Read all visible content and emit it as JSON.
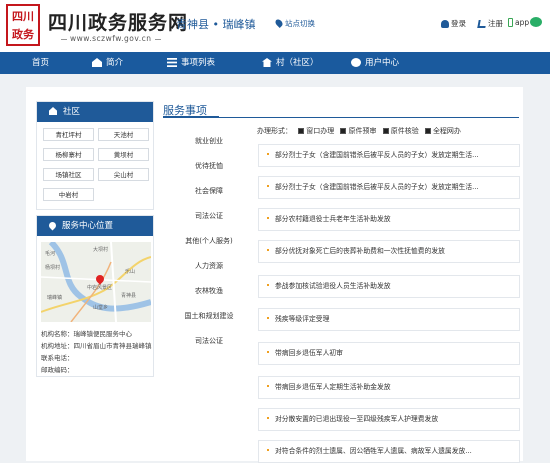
{
  "header": {
    "seal_text": "四川政务",
    "site_title": "四川政务服务网",
    "url": "www.sczwfw.gov.cn",
    "region": "青神县 • 瑞峰镇",
    "switch_label": "站点切换",
    "login_label": "登录",
    "register_label": "注册",
    "app_label": "app"
  },
  "nav": {
    "home": "首页",
    "intro": "简介",
    "list": "事项列表",
    "village": "村（社区）",
    "user": "用户中心"
  },
  "community": {
    "title": "社区",
    "villages": [
      "青杠坪村",
      "天池村",
      "杨柳寨村",
      "黄坝村",
      "场镇社区",
      "尖山村",
      "中岩村"
    ]
  },
  "location": {
    "title": "服务中心位置",
    "map_labels": [
      "毛河",
      "大坝村",
      "杨坝村",
      "乐山",
      "中岩风景区",
      "瑞峰镇",
      "青神县",
      "山堂乡"
    ],
    "name_label": "机构名称：",
    "name_value": "瑞峰镇便民服务中心",
    "address_label": "机构地址：",
    "address_value": "四川省眉山市青神县瑞峰镇",
    "phone_label": "联系电话：",
    "phone_value": "",
    "post_label": "邮政编码：",
    "post_value": ""
  },
  "services": {
    "title": "服务事项",
    "categories": [
      "就业创业",
      "优待抚恤",
      "社会保障",
      "司法公证",
      "其他(个人服务)",
      "人力资源",
      "农林牧渔",
      "国土和规划建设",
      "司法公证"
    ],
    "filter_label": "办理形式：",
    "filters": [
      "窗口办理",
      "原件预审",
      "原件核验",
      "全程网办"
    ],
    "items": [
      "部分烈士子女（含建国前错杀后被平反人员的子女）发放定期生活...",
      "部分烈士子女（含建国前错杀后被平反人员的子女）发放定期生活...",
      "部分农村籍退役士兵老年生活补助发放",
      "部分优抚对象死亡后的丧葬补助费和一次性抚恤费的发放",
      "参战参加核试验退役人员生活补助发放",
      "残疾等级评定受理",
      "带病回乡退伍军人初审",
      "带病回乡退伍军人定期生活补助金发放",
      "对分散安置的已退出现役一至四级残疾军人护理费发放",
      "对符合条件的烈士遗属、因公牺牲军人遗属、病故军人遗属发放..."
    ]
  },
  "colors": {
    "primary": "#1a5a9e",
    "seal": "#c4161c",
    "bullet": "#f0a020"
  }
}
